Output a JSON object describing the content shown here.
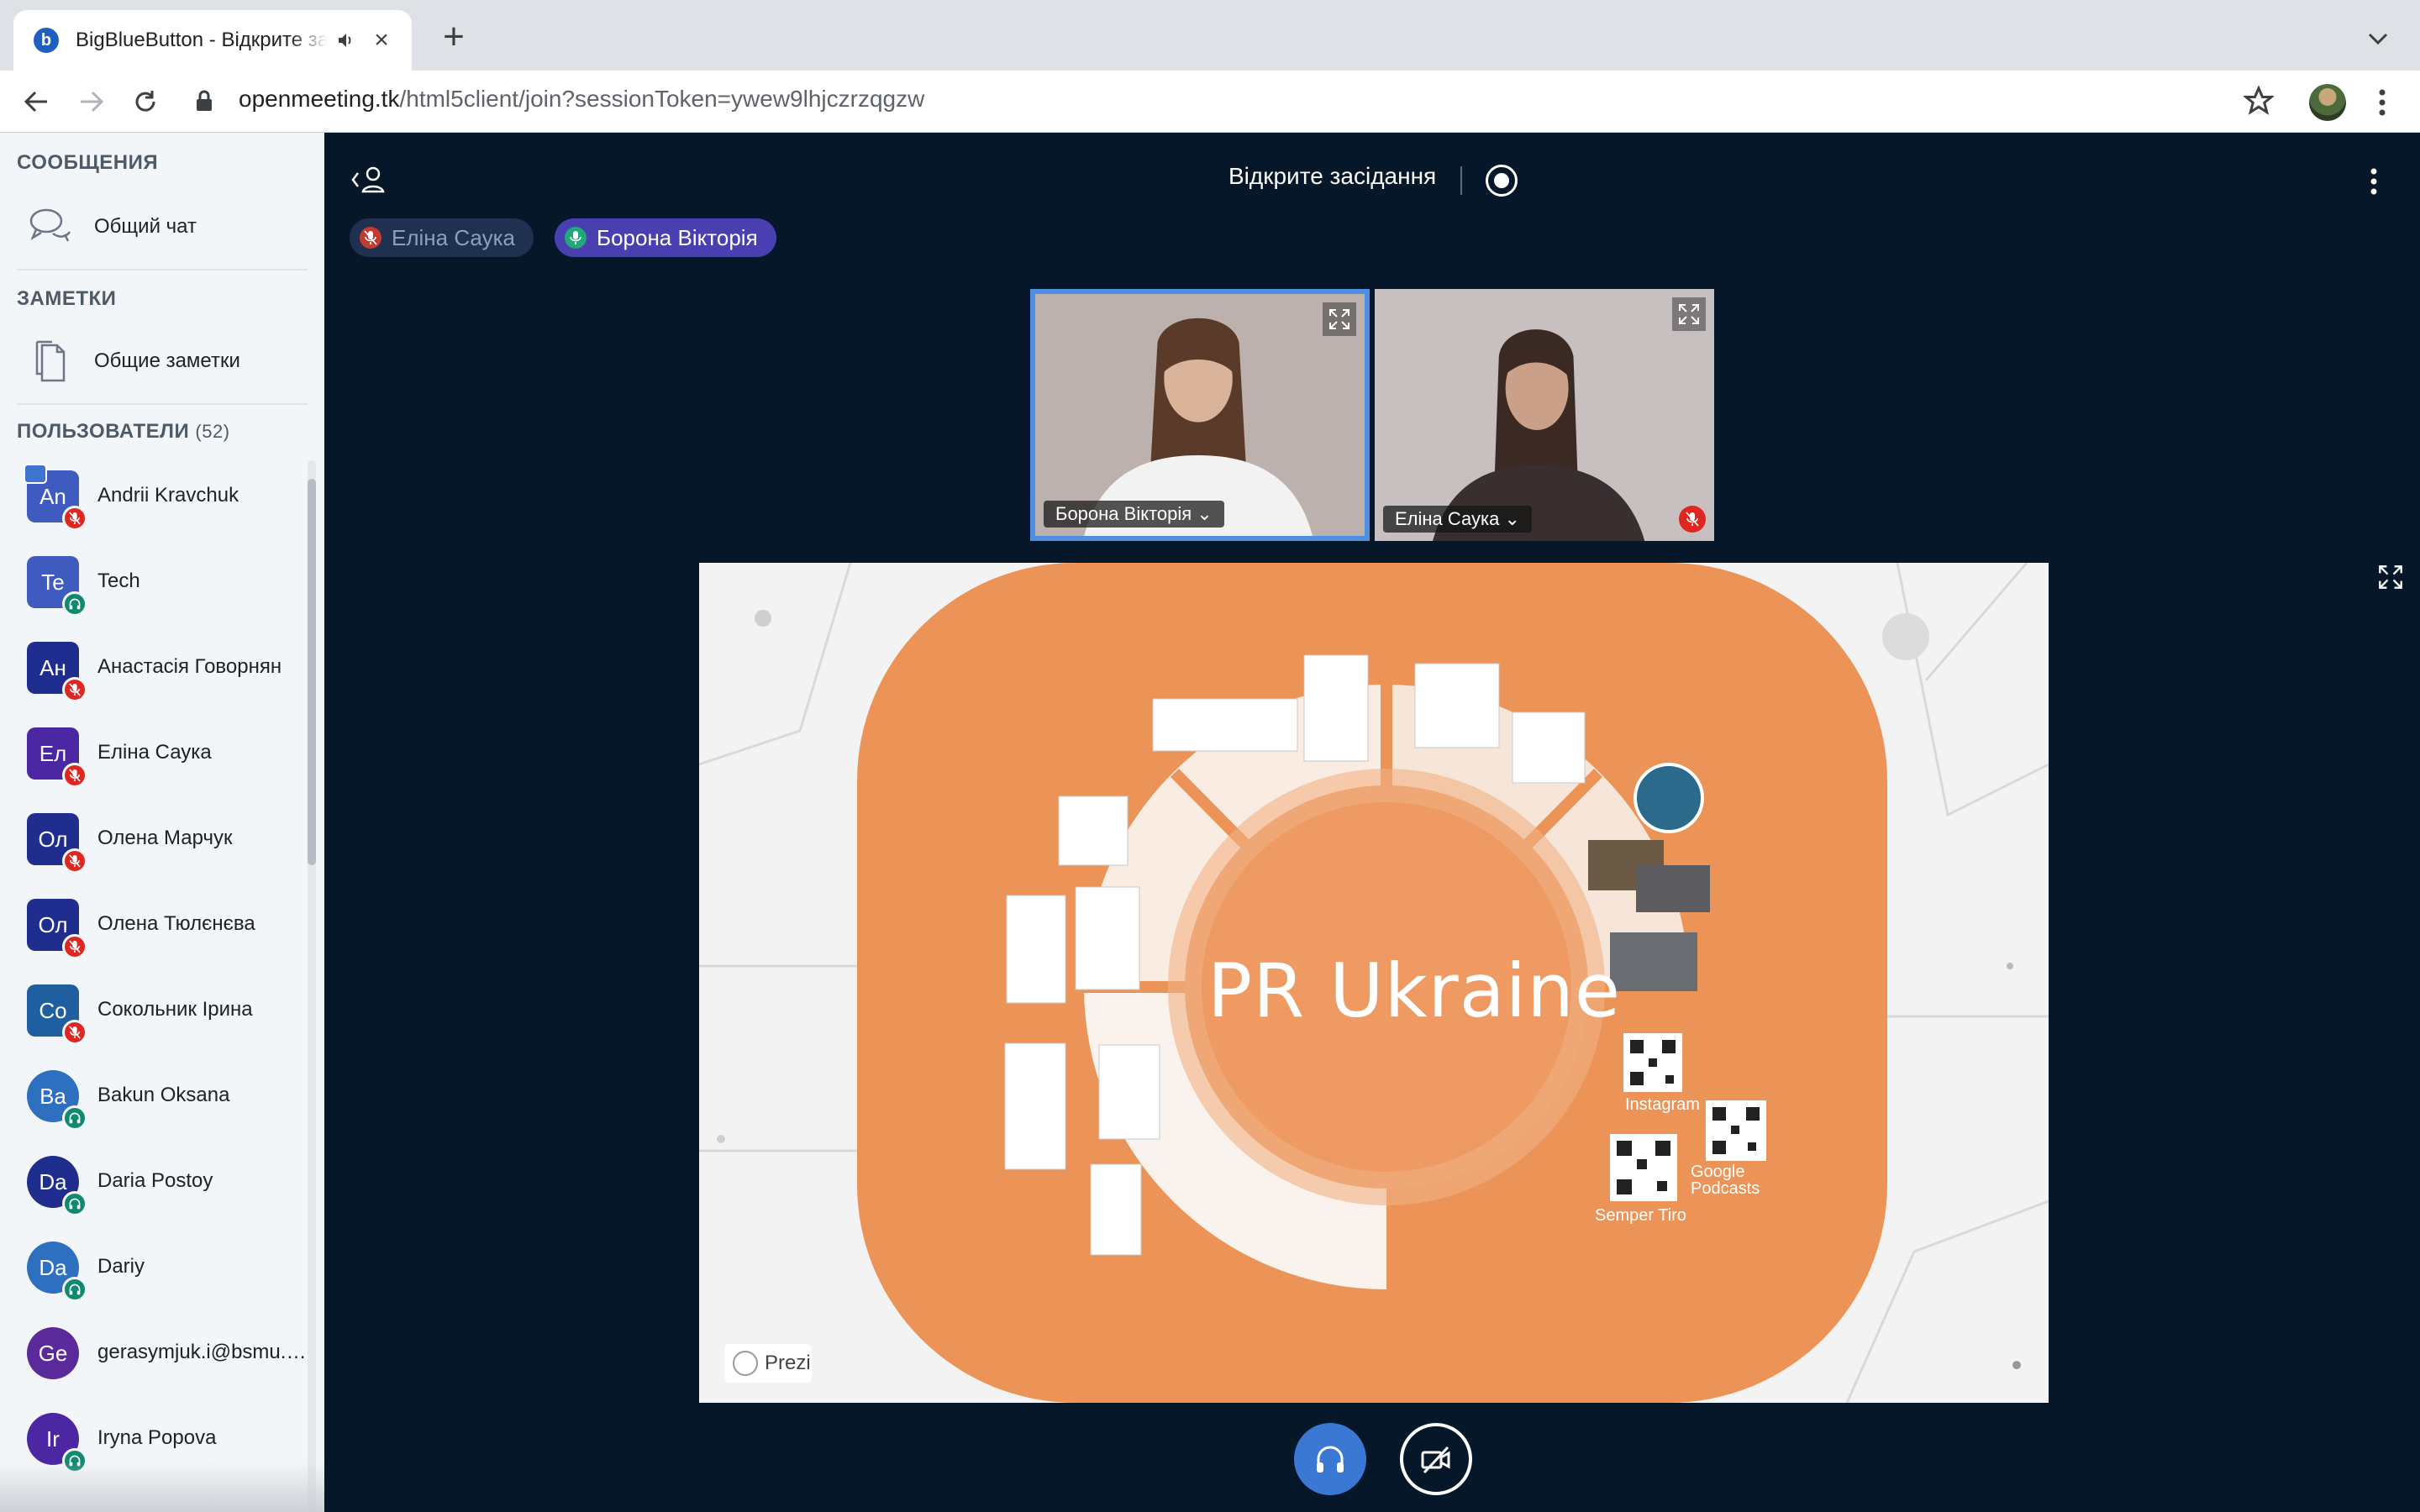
{
  "browser": {
    "tab_title": "BigBlueButton - Відкрите засідання",
    "url_host": "openmeeting.tk",
    "url_path": "/html5client/join?sessionToken=ywew9lhjczrzqgzw"
  },
  "sidebar": {
    "messages_title": "СООБЩЕНИЯ",
    "public_chat": "Общий чат",
    "notes_title": "ЗАМЕТКИ",
    "shared_notes": "Общие заметки",
    "users_title": "ПОЛЬЗОВАТЕЛИ",
    "users_count": "(52)",
    "users": [
      {
        "initials": "An",
        "name": "Andrii Kravchuk",
        "color": "#3f5bbf",
        "status": "muted",
        "presenter": true
      },
      {
        "initials": "Te",
        "name": "Tech",
        "color": "#3f5bbf",
        "status": "listen",
        "presenter": false
      },
      {
        "initials": "Ан",
        "name": "Анастасія Говорнян",
        "color": "#1f2d8f",
        "status": "muted",
        "presenter": false
      },
      {
        "initials": "Ел",
        "name": "Еліна Саука",
        "color": "#4b27a4",
        "status": "muted",
        "presenter": false
      },
      {
        "initials": "Ол",
        "name": "Олена Марчук",
        "color": "#1f2d8f",
        "status": "muted",
        "presenter": false
      },
      {
        "initials": "Ол",
        "name": "Олена Тюлєнєва",
        "color": "#1f2d8f",
        "status": "muted",
        "presenter": false
      },
      {
        "initials": "Со",
        "name": "Сокольник Ірина",
        "color": "#1f5f9f",
        "status": "muted",
        "presenter": false
      },
      {
        "initials": "Ba",
        "name": "Bakun Oksana",
        "color": "#2f6fbf",
        "status": "listen",
        "presenter": false
      },
      {
        "initials": "Da",
        "name": "Daria Postoy",
        "color": "#1f2d8f",
        "status": "listen",
        "presenter": false
      },
      {
        "initials": "Da",
        "name": "Dariy",
        "color": "#2f6fbf",
        "status": "listen",
        "presenter": false
      },
      {
        "initials": "Ge",
        "name": "gerasymjuk.i@bsmu.edu.ua",
        "color": "#5a2a9a",
        "status": "none",
        "presenter": false
      },
      {
        "initials": "Ir",
        "name": "Iryna Popova",
        "color": "#4b27a4",
        "status": "listen",
        "presenter": false
      }
    ]
  },
  "main": {
    "meeting_title": "Відкрите засідання",
    "talkers": [
      "Еліна Саука",
      "Борона Вікторія"
    ],
    "videos": [
      {
        "name": "Борона Вікторія"
      },
      {
        "name": "Еліна Саука"
      }
    ],
    "slide": {
      "title": "PR Ukraine",
      "qr_labels": [
        "Instagram",
        "Google",
        "Podcasts",
        "Semper Tiro"
      ],
      "badge": "Prezi"
    }
  },
  "colors": {
    "accent": "#3b78d4",
    "slide_orange": "#ec9458",
    "muted_red": "#df2721",
    "listen_green": "#0f8a70"
  }
}
